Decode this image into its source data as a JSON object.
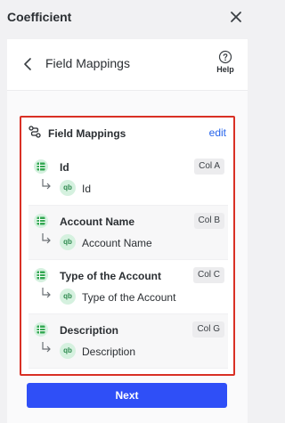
{
  "app": {
    "title": "Coefficient"
  },
  "nav": {
    "title": "Field Mappings",
    "help_label": "Help"
  },
  "card": {
    "title": "Field Mappings",
    "edit_label": "edit"
  },
  "mappings": [
    {
      "field": "Id",
      "column": "Col A",
      "source": "Id"
    },
    {
      "field": "Account Name",
      "column": "Col B",
      "source": "Account Name"
    },
    {
      "field": "Type of the Account",
      "column": "Col C",
      "source": "Type of the Account"
    },
    {
      "field": "Description",
      "column": "Col G",
      "source": "Description"
    }
  ],
  "source_icon_label": "qb",
  "footer": {
    "next_label": "Next"
  },
  "colors": {
    "accent": "#2f4ff7",
    "highlight_border": "#d93025",
    "link": "#2563eb",
    "sheet_green": "#34a853"
  }
}
